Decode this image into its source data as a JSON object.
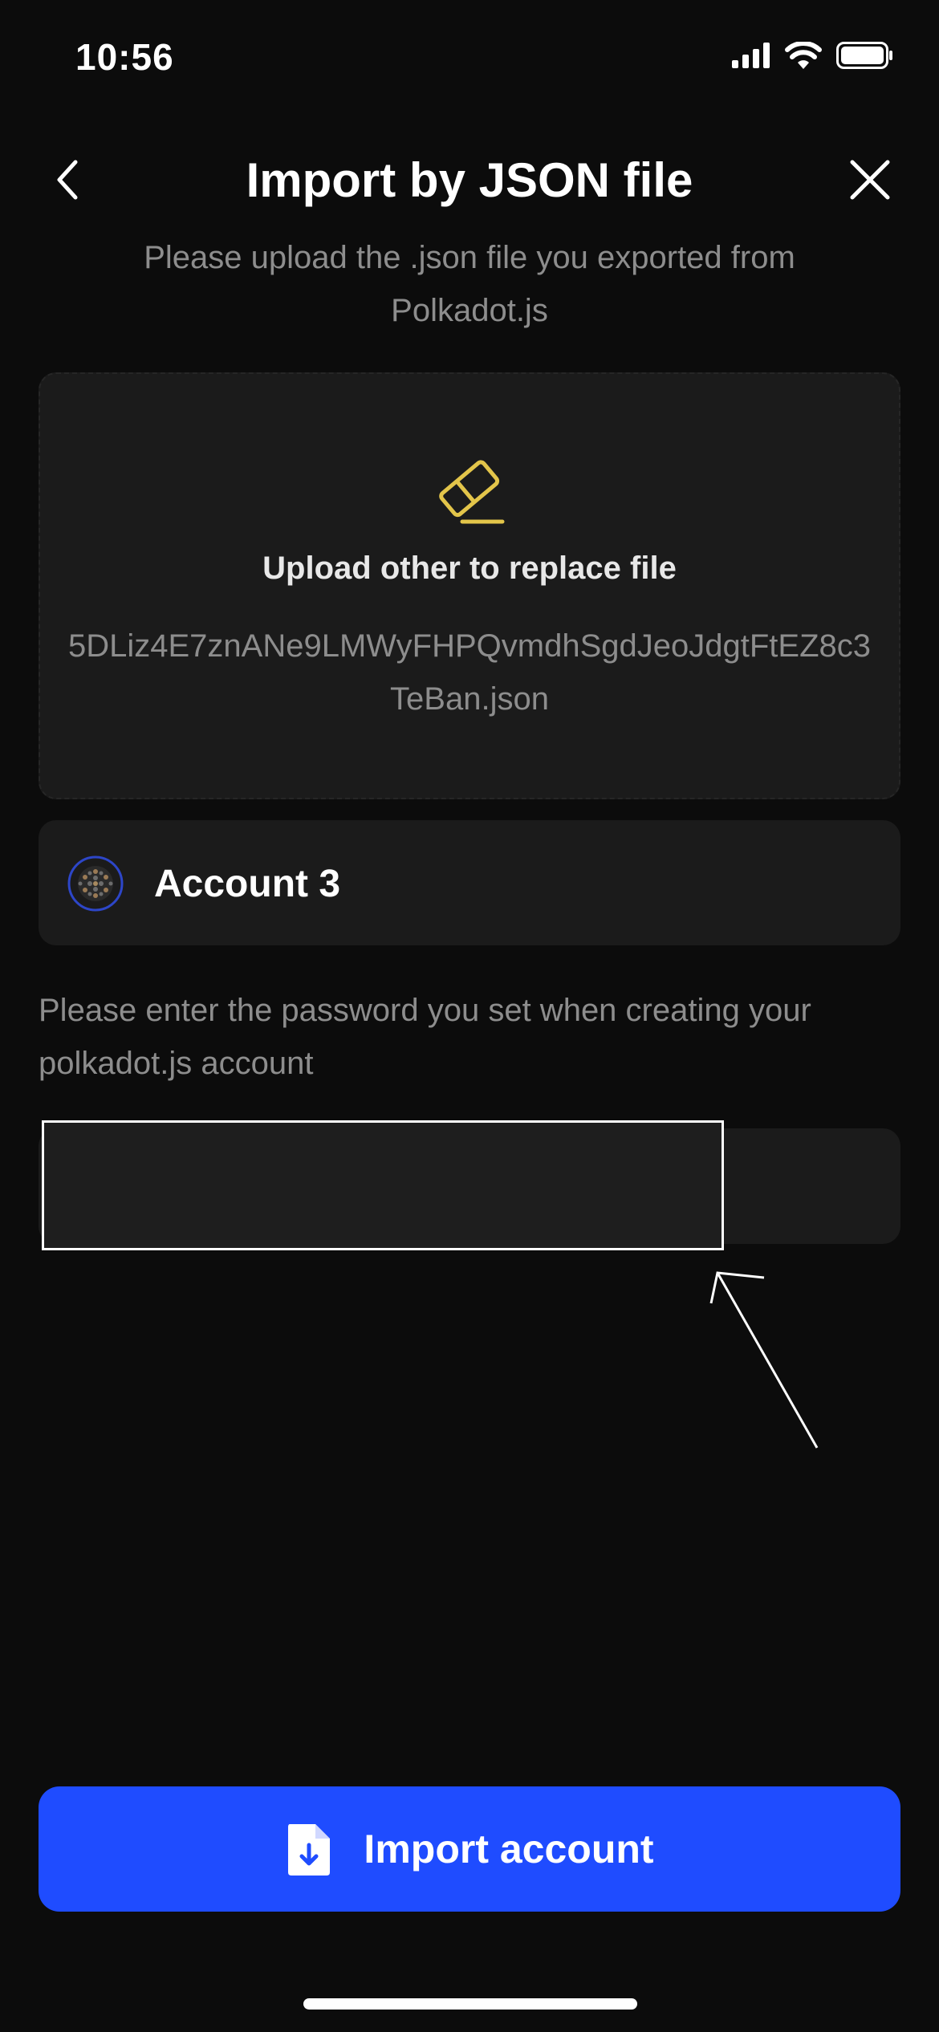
{
  "status": {
    "time": "10:56"
  },
  "header": {
    "title": "Import by JSON file"
  },
  "subtitle": "Please upload the .json file you exported from Polkadot.js",
  "upload": {
    "title": "Upload other to replace file",
    "file_name": "5DLiz4E7znANe9LMWyFHPQvmdhSgdJeoJdgtFtEZ8c3TeBan.json"
  },
  "account": {
    "name": "Account 3"
  },
  "password": {
    "hint": "Please enter the password you set when creating your polkadot.js account",
    "value": ""
  },
  "actions": {
    "import_label": "Import account"
  },
  "colors": {
    "accent": "#1f4cff",
    "background": "#0c0c0c",
    "card": "#1b1b1b",
    "eraser": "#e3c54a"
  }
}
